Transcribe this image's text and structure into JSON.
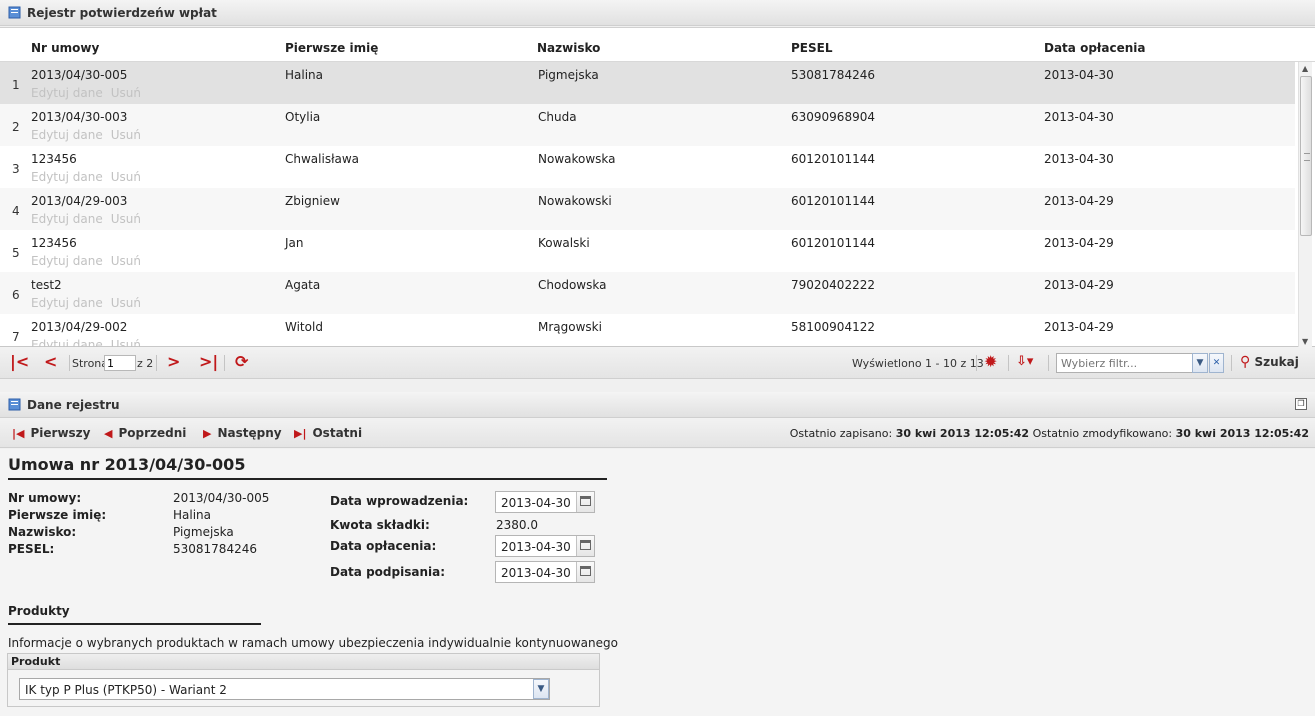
{
  "registry_panel": {
    "title": "Rejestr potwierdzeńw wpłat"
  },
  "grid": {
    "columns": [
      "Nr umowy",
      "Pierwsze imię",
      "Nazwisko",
      "PESEL",
      "Data opłacenia"
    ],
    "row_actions": {
      "edit": "Edytuj dane",
      "delete": "Usuń"
    },
    "rows": [
      {
        "n": "1",
        "nr": "2013/04/30-005",
        "imie": "Halina",
        "nazwisko": "Pigmejska",
        "pesel": "53081784246",
        "data": "2013-04-30"
      },
      {
        "n": "2",
        "nr": "2013/04/30-003",
        "imie": "Otylia",
        "nazwisko": "Chuda",
        "pesel": "63090968904",
        "data": "2013-04-30"
      },
      {
        "n": "3",
        "nr": "123456",
        "imie": "Chwalisława",
        "nazwisko": "Nowakowska",
        "pesel": "60120101144",
        "data": "2013-04-30"
      },
      {
        "n": "4",
        "nr": "2013/04/29-003",
        "imie": "Zbigniew",
        "nazwisko": "Nowakowski",
        "pesel": "60120101144",
        "data": "2013-04-29"
      },
      {
        "n": "5",
        "nr": "123456",
        "imie": "Jan",
        "nazwisko": "Kowalski",
        "pesel": "60120101144",
        "data": "2013-04-29"
      },
      {
        "n": "6",
        "nr": "test2",
        "imie": "Agata",
        "nazwisko": "Chodowska",
        "pesel": "79020402222",
        "data": "2013-04-29"
      },
      {
        "n": "7",
        "nr": "2013/04/29-002",
        "imie": "Witold",
        "nazwisko": "Mrągowski",
        "pesel": "58100904122",
        "data": "2013-04-29"
      }
    ]
  },
  "pager": {
    "page_label": "Strona",
    "page_value": "1",
    "of_label": "z 2",
    "display_info": "Wyświetlono 1 - 10 z 13",
    "filter_placeholder": "Wybierz filtr...",
    "search_label": "Szukaj"
  },
  "detail_panel": {
    "title": "Dane rejestru",
    "nav": {
      "first": "Pierwszy",
      "prev": "Poprzedni",
      "next": "Następny",
      "last": "Ostatni"
    },
    "saved_label": "Ostatnio zapisano:",
    "saved_value": "30 kwi 2013 12:05:42",
    "modified_label": "Ostatnio zmodyfikowano:",
    "modified_value": "30 kwi 2013 12:05:42"
  },
  "record": {
    "heading": "Umowa nr 2013/04/30-005",
    "nr_label": "Nr umowy:",
    "nr_value": "2013/04/30-005",
    "imie_label": "Pierwsze imię:",
    "imie_value": "Halina",
    "nazwisko_label": "Nazwisko:",
    "nazwisko_value": "Pigmejska",
    "pesel_label": "PESEL:",
    "pesel_value": "53081784246",
    "data_wpr_label": "Data wprowadzenia:",
    "data_wpr_value": "2013-04-30",
    "kwota_label": "Kwota składki:",
    "kwota_value": "2380.0",
    "data_opl_label": "Data opłacenia:",
    "data_opl_value": "2013-04-30",
    "data_podp_label": "Data podpisania:",
    "data_podp_value": "2013-04-30"
  },
  "products": {
    "title": "Produkty",
    "description": "Informacje o wybranych produktach w ramach umowy ubezpieczenia indywidualnie kontynuowanego",
    "column": "Produkt",
    "selected": "IK typ P Plus (PTKP50) - Wariant 2"
  },
  "colors": {
    "accent_red": "#c0181a",
    "selected_row": "#e1e1e1"
  }
}
